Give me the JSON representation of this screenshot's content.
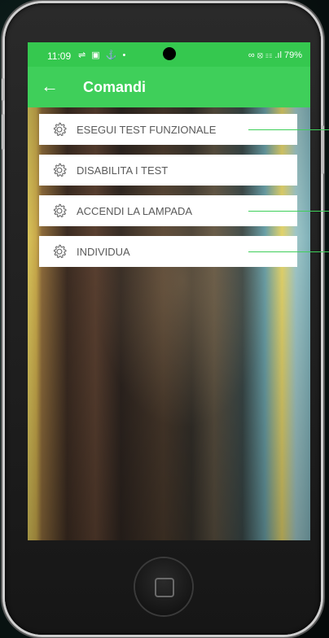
{
  "status_bar": {
    "time": "11:09",
    "left_icons": "⇌ ▣ ⚓ •",
    "right_text": "∞ ⦻ ☷ .ıl 79%"
  },
  "app_bar": {
    "back_icon": "←",
    "title": "Comandi"
  },
  "commands": [
    {
      "label": "ESEGUI TEST FUNZIONALE",
      "icon": "gear-icon"
    },
    {
      "label": "DISABILITA I TEST",
      "icon": "gear-icon"
    },
    {
      "label": "ACCENDI LA LAMPADA",
      "icon": "gear-icon"
    },
    {
      "label": "INDIVIDUA",
      "icon": "gear-icon"
    }
  ],
  "colors": {
    "accent": "#3fcf5a",
    "status_bar": "#35c84f"
  }
}
